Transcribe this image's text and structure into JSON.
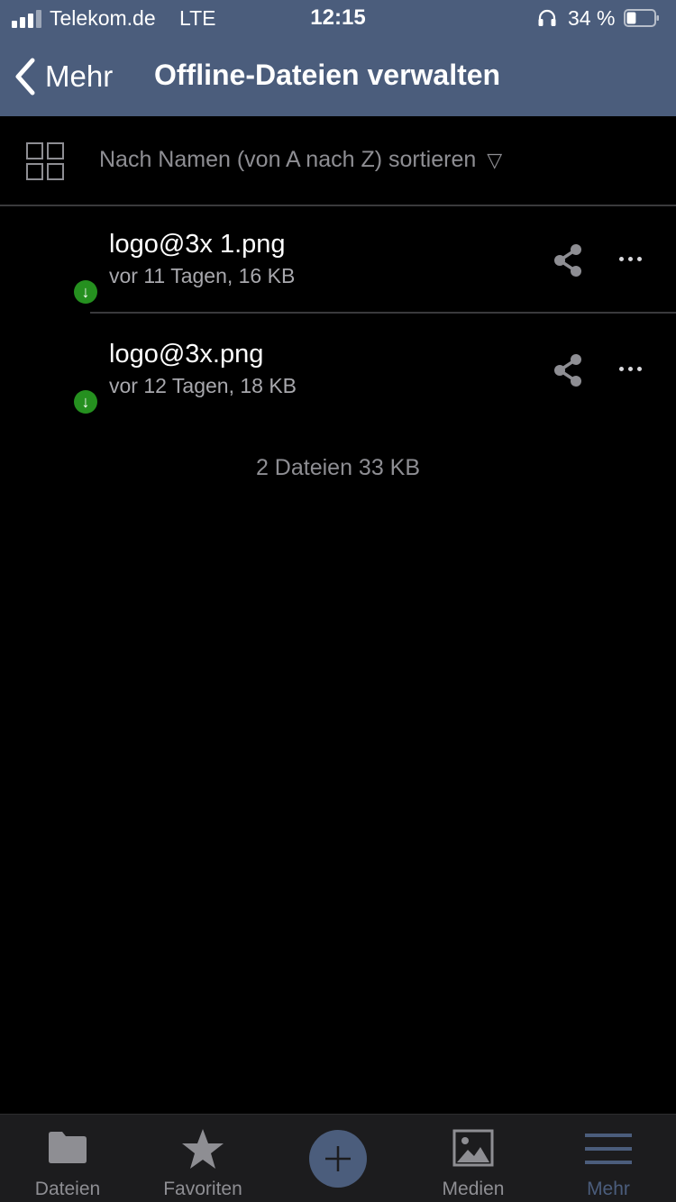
{
  "status_bar": {
    "carrier": "Telekom.de",
    "network": "LTE",
    "time": "12:15",
    "battery_percent": "34 %",
    "battery_level": 0.34
  },
  "nav": {
    "back_label": "Mehr",
    "title": "Offline-Dateien verwalten"
  },
  "toolbar": {
    "sort_label": "Nach Namen (von A nach Z) sortieren",
    "sort_indicator": "▽"
  },
  "files": [
    {
      "name": "logo@3x 1.png",
      "meta": "vor 11 Tagen, 16 KB",
      "badge": "↓"
    },
    {
      "name": "logo@3x.png",
      "meta": "vor 12 Tagen, 18 KB",
      "badge": "↓"
    }
  ],
  "summary": "2 Dateien 33 KB",
  "tab_bar": {
    "tabs": [
      {
        "label": "Dateien",
        "icon": "folder-icon"
      },
      {
        "label": "Favoriten",
        "icon": "star-icon"
      },
      {
        "label": "",
        "icon": "plus-icon"
      },
      {
        "label": "Medien",
        "icon": "image-icon"
      },
      {
        "label": "Mehr",
        "icon": "menu-icon",
        "active": true
      }
    ]
  },
  "colors": {
    "header_bg": "#4b5d7c",
    "accent": "#4b5d7c",
    "offline_badge": "#25901f",
    "background": "#000000"
  }
}
